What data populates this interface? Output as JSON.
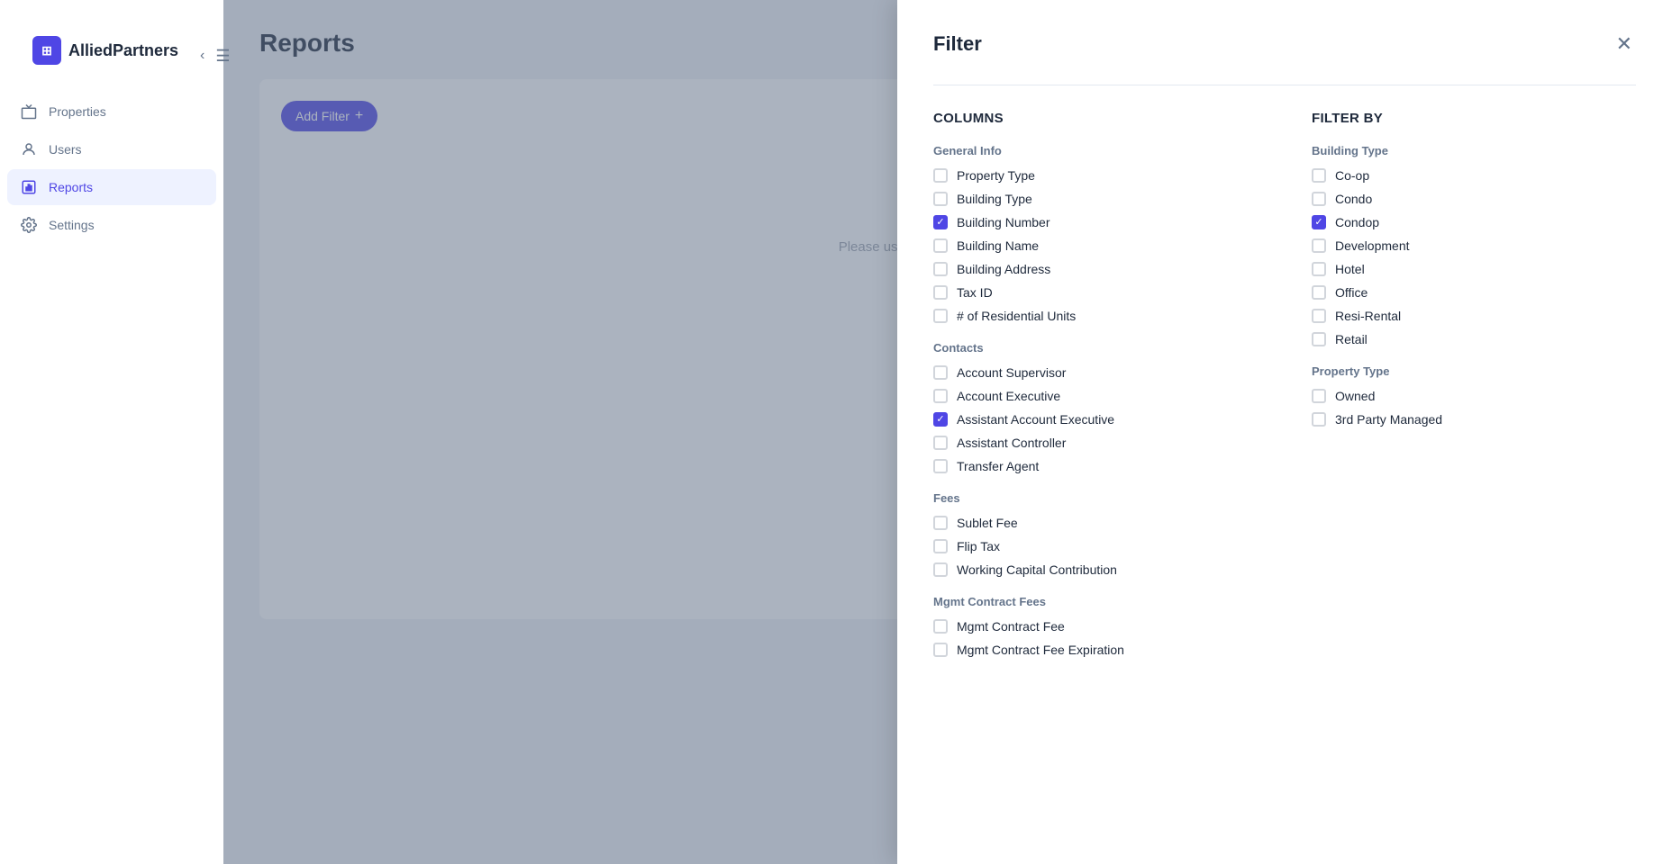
{
  "app": {
    "name": "AlliedPartners",
    "logo_icon": "⊞"
  },
  "sidebar": {
    "items": [
      {
        "id": "properties",
        "label": "Properties",
        "icon": "🏠",
        "active": false
      },
      {
        "id": "users",
        "label": "Users",
        "icon": "👤",
        "active": false
      },
      {
        "id": "reports",
        "label": "Reports",
        "icon": "📊",
        "active": true
      },
      {
        "id": "settings",
        "label": "Settings",
        "icon": "⚙️",
        "active": false
      }
    ]
  },
  "main": {
    "title": "Reports",
    "add_filter_label": "Add Filter",
    "placeholder": "Please use filters to run a custom r..."
  },
  "filter_panel": {
    "title": "Filter",
    "columns_heading": "Columns",
    "filter_by_heading": "Filter By",
    "sections": {
      "general_info": {
        "label": "General Info",
        "items": [
          {
            "id": "property_type",
            "label": "Property Type",
            "checked": false
          },
          {
            "id": "building_type",
            "label": "Building Type",
            "checked": false
          },
          {
            "id": "building_number",
            "label": "Building Number",
            "checked": true
          },
          {
            "id": "building_name",
            "label": "Building Name",
            "checked": false
          },
          {
            "id": "building_address",
            "label": "Building Address",
            "checked": false
          },
          {
            "id": "tax_id",
            "label": "Tax ID",
            "checked": false
          },
          {
            "id": "residential_units",
            "label": "# of Residential Units",
            "checked": false
          }
        ]
      },
      "contacts": {
        "label": "Contacts",
        "items": [
          {
            "id": "account_supervisor",
            "label": "Account Supervisor",
            "checked": false
          },
          {
            "id": "account_executive",
            "label": "Account Executive",
            "checked": false
          },
          {
            "id": "assistant_account_executive",
            "label": "Assistant Account Executive",
            "checked": true
          },
          {
            "id": "assistant_controller",
            "label": "Assistant Controller",
            "checked": false
          },
          {
            "id": "transfer_agent",
            "label": "Transfer Agent",
            "checked": false
          }
        ]
      },
      "fees": {
        "label": "Fees",
        "items": [
          {
            "id": "sublet_fee",
            "label": "Sublet Fee",
            "checked": false
          },
          {
            "id": "flip_tax",
            "label": "Flip Tax",
            "checked": false
          },
          {
            "id": "working_capital",
            "label": "Working Capital Contribution",
            "checked": false
          }
        ]
      },
      "mgmt_contract_fees": {
        "label": "Mgmt Contract Fees",
        "items": [
          {
            "id": "mgmt_contract_fee",
            "label": "Mgmt Contract Fee",
            "checked": false
          },
          {
            "id": "mgmt_contract_fee_expiration",
            "label": "Mgmt Contract Fee Expiration",
            "checked": false
          }
        ]
      }
    },
    "filter_by": {
      "building_type": {
        "label": "Building Type",
        "items": [
          {
            "id": "coop",
            "label": "Co-op",
            "checked": false
          },
          {
            "id": "condo",
            "label": "Condo",
            "checked": false
          },
          {
            "id": "condop",
            "label": "Condop",
            "checked": true
          },
          {
            "id": "development",
            "label": "Development",
            "checked": false
          },
          {
            "id": "hotel",
            "label": "Hotel",
            "checked": false
          },
          {
            "id": "office",
            "label": "Office",
            "checked": false
          },
          {
            "id": "resi_rental",
            "label": "Resi-Rental",
            "checked": false
          },
          {
            "id": "retail",
            "label": "Retail",
            "checked": false
          }
        ]
      },
      "property_type": {
        "label": "Property Type",
        "items": [
          {
            "id": "owned",
            "label": "Owned",
            "checked": false
          },
          {
            "id": "third_party",
            "label": "3rd Party Managed",
            "checked": false
          }
        ]
      }
    }
  }
}
